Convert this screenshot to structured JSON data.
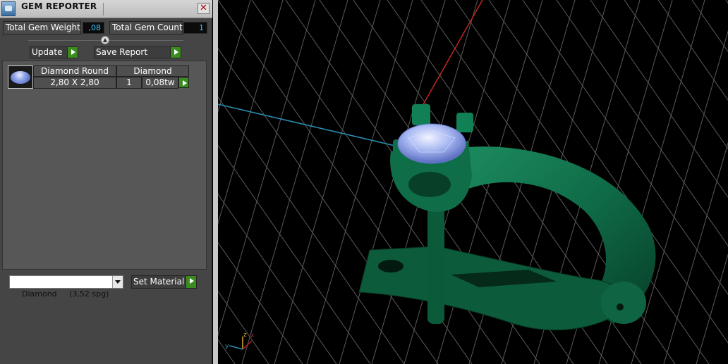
{
  "window": {
    "title": "GEM REPORTER",
    "close_glyph": "✕"
  },
  "stats": {
    "total_weight_label": "Total Gem Weight",
    "total_weight_value": ",08",
    "total_count_label": "Total Gem Count",
    "total_count_value": "1"
  },
  "actions": {
    "update_label": "Update",
    "save_report_label": "Save Report"
  },
  "gem_table": {
    "shape_header": "Diamond Round",
    "material_header": "Diamond",
    "size": "2,80 X 2,80",
    "quantity": "1",
    "weight": "0,08tw"
  },
  "material": {
    "selected": "Diamond     (3,52 spg)",
    "set_material_label": "Set Material"
  },
  "viewport": {
    "axis_labels": {
      "x": "x",
      "y": "y",
      "z": "z"
    },
    "colors": {
      "model": "#0f6b47",
      "grid": "#5a5a5a",
      "x_axis": "#c0281e",
      "y_axis": "#2a8fb0",
      "stone": "#a9b9f2"
    }
  }
}
